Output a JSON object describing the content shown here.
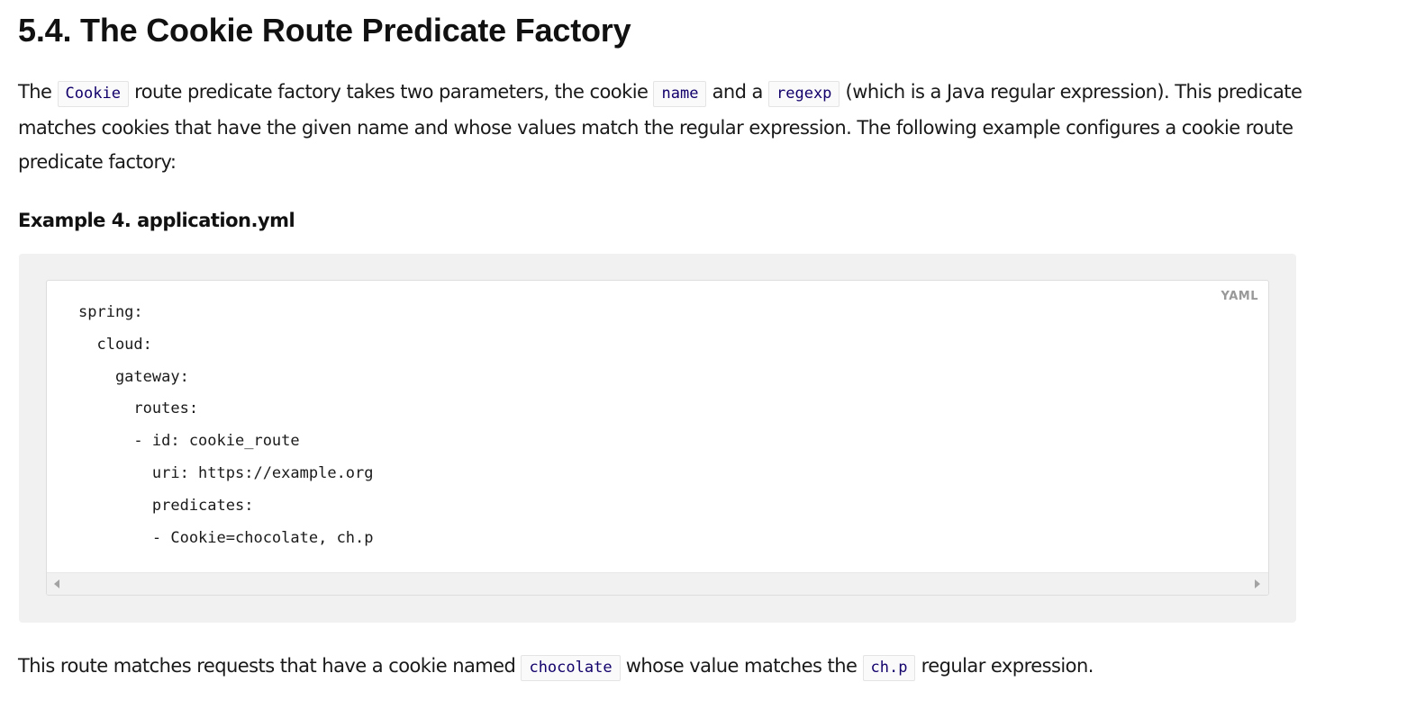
{
  "heading": "5.4. The Cookie Route Predicate Factory",
  "intro": {
    "t1": "The ",
    "c1": "Cookie",
    "t2": " route predicate factory takes two parameters, the cookie ",
    "c2": "name",
    "t3": " and a ",
    "c3": "regexp",
    "t4": " (which is a Java regular expression). This predicate matches cookies that have the given name and whose values match the regular expression. The following example configures a cookie route predicate factory:"
  },
  "example": {
    "caption": "Example 4. application.yml",
    "language": "YAML",
    "lines": [
      "spring:",
      "  cloud:",
      "    gateway:",
      "      routes:",
      "      - id: cookie_route",
      "        uri: https://example.org",
      "        predicates:",
      "        - Cookie=chocolate, ch.p"
    ]
  },
  "outro": {
    "t1": "This route matches requests that have a cookie named ",
    "c1": "chocolate",
    "t2": " whose value matches the ",
    "c2": "ch.p",
    "t3": " regular expression."
  }
}
